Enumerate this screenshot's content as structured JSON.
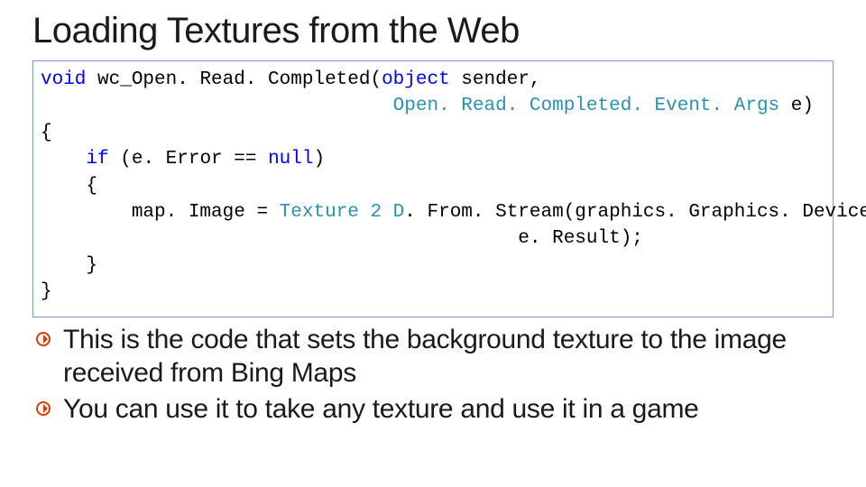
{
  "title": "Loading Textures from the Web",
  "code": {
    "tokens": [
      {
        "t": "void",
        "c": "kw"
      },
      {
        "t": " wc_Open. Read. Completed("
      },
      {
        "t": "object",
        "c": "kw"
      },
      {
        "t": " sender,\n                               "
      },
      {
        "t": "Open. Read. Completed. Event. Args",
        "c": "typ"
      },
      {
        "t": " e)\n{\n    "
      },
      {
        "t": "if",
        "c": "kw"
      },
      {
        "t": " (e. Error == "
      },
      {
        "t": "null",
        "c": "kw"
      },
      {
        "t": ")\n    {\n        map. Image = "
      },
      {
        "t": "Texture 2 D",
        "c": "typ"
      },
      {
        "t": ". From. Stream(graphics. Graphics. Device,\n                                          e. Result);\n    }\n}"
      }
    ]
  },
  "bullets": [
    "This is the code that sets the background texture to the image received from Bing Maps",
    "You can use it to take any texture and use it in a game"
  ],
  "bullet_color": "#d83b01"
}
